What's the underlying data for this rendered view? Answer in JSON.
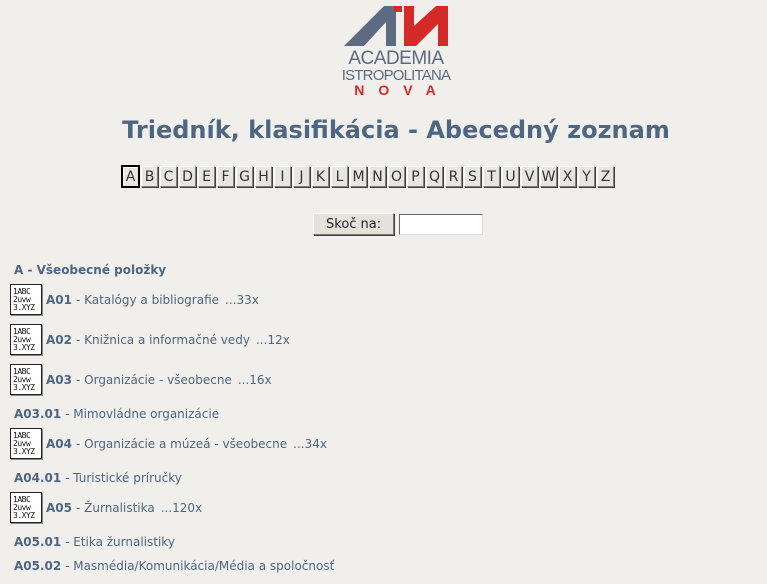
{
  "logo": {
    "line1": "ACADEMIA",
    "line2": "ISTROPOLITANA",
    "line3": "NOVA",
    "colors": {
      "gray": "#5c6b82",
      "red": "#d42a2a"
    }
  },
  "page": {
    "title": "Triedník, klasifikácia - Abecedný zoznam"
  },
  "alphabet": [
    "A",
    "B",
    "C",
    "D",
    "E",
    "F",
    "G",
    "H",
    "I",
    "J",
    "K",
    "L",
    "M",
    "N",
    "O",
    "P",
    "Q",
    "R",
    "S",
    "T",
    "U",
    "V",
    "W",
    "X",
    "Y",
    "Z"
  ],
  "active_letter": "A",
  "jump": {
    "button_label": "Skoč na:",
    "input_value": ""
  },
  "section": {
    "heading": "A - Všeobecné položky"
  },
  "icon": {
    "name": "classification-icon",
    "lines": [
      "1ABC",
      "2uvw",
      "3.XYZ"
    ]
  },
  "entries": [
    {
      "code": "A01",
      "label": "- Katalógy a bibliografie",
      "count": "...33x"
    },
    {
      "code": "A02",
      "label": "- Knižnica a informačné vedy",
      "count": "...12x"
    },
    {
      "code": "A03",
      "label": "- Organizácie - všeobecne",
      "count": "...16x"
    },
    {
      "code": "A04",
      "label": "- Organizácie a múzeá - všeobecne",
      "count": "...34x"
    },
    {
      "code": "A05",
      "label": "- Žurnalistika",
      "count": "...120x"
    }
  ],
  "subentries": [
    {
      "code": "A03.01",
      "label": "- Mimovládne organizácie"
    },
    {
      "code": "A04.01",
      "label": "- Turistické príručky"
    },
    {
      "code": "A05.01",
      "label": "- Etika žurnalistiky"
    },
    {
      "code": "A05.02",
      "label": "- Masmédia/Komunikácia/Média a spoločnosť"
    }
  ],
  "colors": {
    "background": "#f0efeb",
    "text": "#4e6682"
  }
}
